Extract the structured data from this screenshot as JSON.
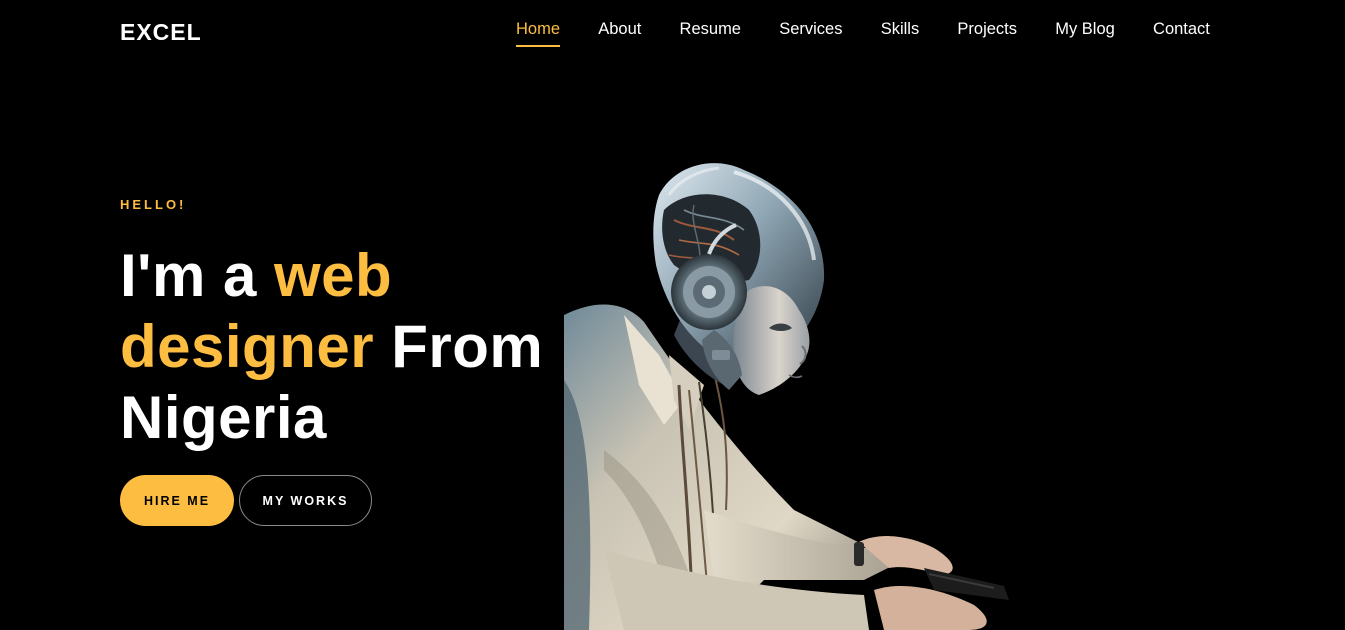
{
  "brand": {
    "name": "EXCEL"
  },
  "nav": {
    "items": [
      {
        "label": "Home",
        "active": true
      },
      {
        "label": "About"
      },
      {
        "label": "Resume"
      },
      {
        "label": "Services"
      },
      {
        "label": "Skills"
      },
      {
        "label": "Projects"
      },
      {
        "label": "My Blog"
      },
      {
        "label": "Contact"
      }
    ]
  },
  "hero": {
    "eyebrow": "HELLO!",
    "headline": {
      "part1": "I'm a ",
      "accent1": "web designer",
      "part2": " From Nigeria"
    },
    "primary_button": "HIRE ME",
    "secondary_button": "MY WORKS",
    "image_icon": "robot-typing-illustration"
  },
  "colors": {
    "background": "#000000",
    "accent": "#fdbd41",
    "text": "#ffffff"
  }
}
